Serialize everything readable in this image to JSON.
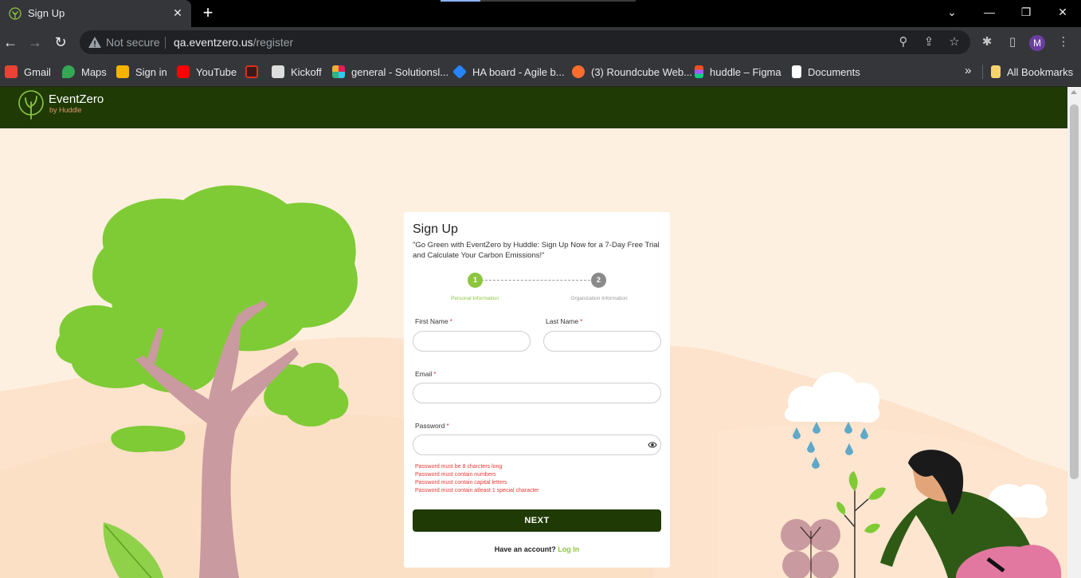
{
  "browser": {
    "tab_title": "Sign Up",
    "tab_close": "✕",
    "new_tab": "+",
    "address": {
      "security_label": "Not secure",
      "host": "qa.eventzero.us",
      "path": "/register"
    },
    "profile_initial": "M",
    "bookmarks": [
      {
        "label": "Gmail",
        "icon": "gmail-icon",
        "color": "#ea4335"
      },
      {
        "label": "Maps",
        "icon": "maps-icon",
        "color": "#34a853"
      },
      {
        "label": "Sign in",
        "icon": "signin-icon",
        "color": "#f4b400"
      },
      {
        "label": "YouTube",
        "icon": "youtube-icon",
        "color": "#ff0000"
      },
      {
        "label": "",
        "icon": "app-icon",
        "color": "#d93025"
      },
      {
        "label": "Kickoff",
        "icon": "document-icon",
        "color": "#dddddd"
      },
      {
        "label": "general - Solutionsl...",
        "icon": "slack-icon",
        "color": "#e01e5a"
      },
      {
        "label": "HA board - Agile b...",
        "icon": "jira-icon",
        "color": "#2684ff"
      },
      {
        "label": "(3) Roundcube Web...",
        "icon": "cpanel-icon",
        "color": "#ff6c2c"
      },
      {
        "label": "huddle – Figma",
        "icon": "figma-icon",
        "color": "#a259ff"
      },
      {
        "label": "Documents",
        "icon": "notion-icon",
        "color": "#ffffff"
      }
    ],
    "bookmarks_more": "»",
    "all_bookmarks": "All Bookmarks"
  },
  "site": {
    "logo_name": "EventZero",
    "logo_sub": "by Huddle"
  },
  "form": {
    "title": "Sign Up",
    "subtitle": "\"Go Green with EventZero by Huddle: Sign Up Now for a 7-Day Free Trial and Calculate Your Carbon Emissions!\"",
    "steps": [
      {
        "number": "1",
        "label": "Personal Information",
        "active": true
      },
      {
        "number": "2",
        "label": "Organization Information",
        "active": false
      }
    ],
    "fields": {
      "first_name": {
        "label": "First Name",
        "value": ""
      },
      "last_name": {
        "label": "Last Name",
        "value": ""
      },
      "email": {
        "label": "Email",
        "value": ""
      },
      "password": {
        "label": "Password",
        "value": ""
      }
    },
    "required_mark": "*",
    "password_errors": [
      "Password must be 8 charcters long",
      "Password must contain numbers",
      "Password must contain capital letters",
      "Password must contain atleast 1 special character"
    ],
    "next_label": "NEXT",
    "have_account": "Have an account?",
    "login_label": "Log In"
  },
  "colors": {
    "header_green": "#1f3a05",
    "accent_green": "#8cc63f",
    "page_bg": "#fdf0e0",
    "error_red": "#e53935"
  }
}
